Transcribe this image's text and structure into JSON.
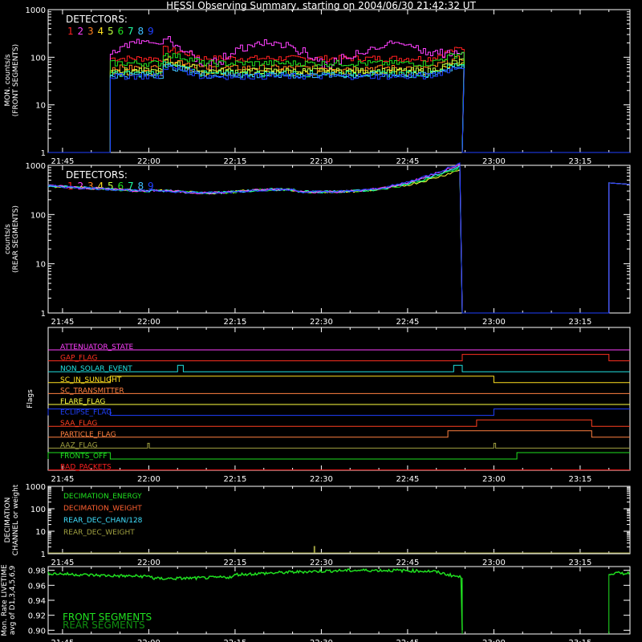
{
  "title": "HESSI Observing Summary, starting on 2004/06/30 21:42:32 UT",
  "time_ticks": [
    "21:45",
    "22:00",
    "22:15",
    "22:30",
    "22:45",
    "23:00",
    "23:15"
  ],
  "detectors_label": "DETECTORS:",
  "detector_colors": [
    "#ff2020",
    "#ff40ff",
    "#ff8020",
    "#ffe020",
    "#c0ff40",
    "#20e020",
    "#20ffa0",
    "#40c0ff",
    "#2040ff"
  ],
  "panel1": {
    "ylabel1": "MON. counts/s",
    "ylabel2": "(FRONT SEGMENTS)",
    "yticks": [
      "1",
      "10",
      "100",
      "1000"
    ]
  },
  "panel2": {
    "ylabel1": "counts/s",
    "ylabel2": "(REAR SEGMENTS)",
    "yticks": [
      "1",
      "10",
      "100",
      "1000"
    ]
  },
  "flags": {
    "ylabel": "Flags",
    "items": [
      {
        "name": "ATTENUATOR_STATE",
        "color": "#ff40ff"
      },
      {
        "name": "GAP_FLAG",
        "color": "#ff3020"
      },
      {
        "name": "NON_SOLAR_EVENT",
        "color": "#20e0e0"
      },
      {
        "name": "SC_IN_SUNLIGHT",
        "color": "#ffe020"
      },
      {
        "name": "SC_TRANSMITTER",
        "color": "#ff8040"
      },
      {
        "name": "FLARE_FLAG",
        "color": "#ffff40"
      },
      {
        "name": "ECLIPSE_FLAG",
        "color": "#2040ff"
      },
      {
        "name": "SAA_FLAG",
        "color": "#ff4020"
      },
      {
        "name": "PARTICLE_FLAG",
        "color": "#ff8040"
      },
      {
        "name": "AAZ_FLAG",
        "color": "#a0a040"
      },
      {
        "name": "FRONTS_OFF",
        "color": "#20e020"
      },
      {
        "name": "BAD_PACKETS",
        "color": "#ff2020"
      }
    ]
  },
  "decimation": {
    "ylabel1": "DECIMATION",
    "ylabel2": "CHANNEL or weight",
    "yticks": [
      "1",
      "10",
      "100",
      "1000"
    ],
    "legend": [
      {
        "name": "DECIMATION_ENERGY",
        "color": "#20e020"
      },
      {
        "name": "DECIMATION_WEIGHT",
        "color": "#ff6030"
      },
      {
        "name": "REAR_DEC_CHAN/128",
        "color": "#40e0ff"
      },
      {
        "name": "REAR_DEC_WEIGHT",
        "color": "#a0a040"
      }
    ]
  },
  "livetime": {
    "ylabel1": "Mon. Rate LIVETIME",
    "ylabel2": "avg of D1,3,4,5,6,9",
    "yticks": [
      "0.90",
      "0.92",
      "0.94",
      "0.96",
      "0.98"
    ],
    "legend": [
      {
        "name": "FRONT SEGMENTS",
        "color": "#20e020"
      },
      {
        "name": "REAR SEGMENTS",
        "color": "#109010"
      }
    ]
  },
  "chart_data": [
    {
      "type": "line",
      "title": "HESSI Observing Summary, starting on 2004/06/30 21:42:32 UT",
      "ylabel": "MON. counts/s (FRONT SEGMENTS)",
      "yscale": "log",
      "ylim": [
        1,
        1000
      ],
      "x": [
        "21:42",
        "21:53",
        "22:08",
        "22:15",
        "22:30",
        "22:45",
        "22:54",
        "22:55",
        "23:22"
      ],
      "series": [
        {
          "name": "1",
          "values": [
            1,
            90,
            150,
            95,
            90,
            85,
            130,
            1,
            1
          ]
        },
        {
          "name": "2",
          "values": [
            1,
            110,
            180,
            100,
            120,
            90,
            150,
            1,
            1
          ]
        },
        {
          "name": "4",
          "values": [
            1,
            45,
            120,
            55,
            50,
            50,
            70,
            1,
            1
          ]
        },
        {
          "name": "9",
          "values": [
            1,
            35,
            110,
            45,
            42,
            42,
            55,
            1,
            1
          ]
        }
      ]
    },
    {
      "type": "line",
      "ylabel": "counts/s (REAR SEGMENTS)",
      "yscale": "log",
      "ylim": [
        1,
        1000
      ],
      "x": [
        "21:42",
        "22:00",
        "22:15",
        "22:30",
        "22:45",
        "22:54",
        "22:55",
        "23:20",
        "23:22"
      ],
      "series": [
        {
          "name": "all",
          "values": [
            380,
            290,
            300,
            280,
            300,
            700,
            1,
            430,
            410
          ]
        }
      ]
    },
    {
      "type": "line",
      "ylabel": "DECIMATION CHANNEL or weight",
      "yscale": "log",
      "ylim": [
        1,
        1000
      ],
      "x": [
        "21:42",
        "22:28",
        "22:29",
        "23:22"
      ],
      "series": [
        {
          "name": "REAR_DEC_WEIGHT",
          "values": [
            1,
            1,
            2,
            1
          ]
        }
      ]
    },
    {
      "type": "line",
      "ylabel": "Mon. Rate LIVETIME avg of D1,3,4,5,6,9",
      "ylim": [
        0.9,
        0.99
      ],
      "x": [
        "21:42",
        "22:15",
        "22:30",
        "22:45",
        "22:54",
        "22:55",
        "23:20",
        "23:22"
      ],
      "series": [
        {
          "name": "FRONT SEGMENTS",
          "values": [
            0.976,
            0.973,
            0.977,
            0.975,
            0.97,
            0.9,
            0.976,
            0.977
          ]
        }
      ]
    }
  ]
}
